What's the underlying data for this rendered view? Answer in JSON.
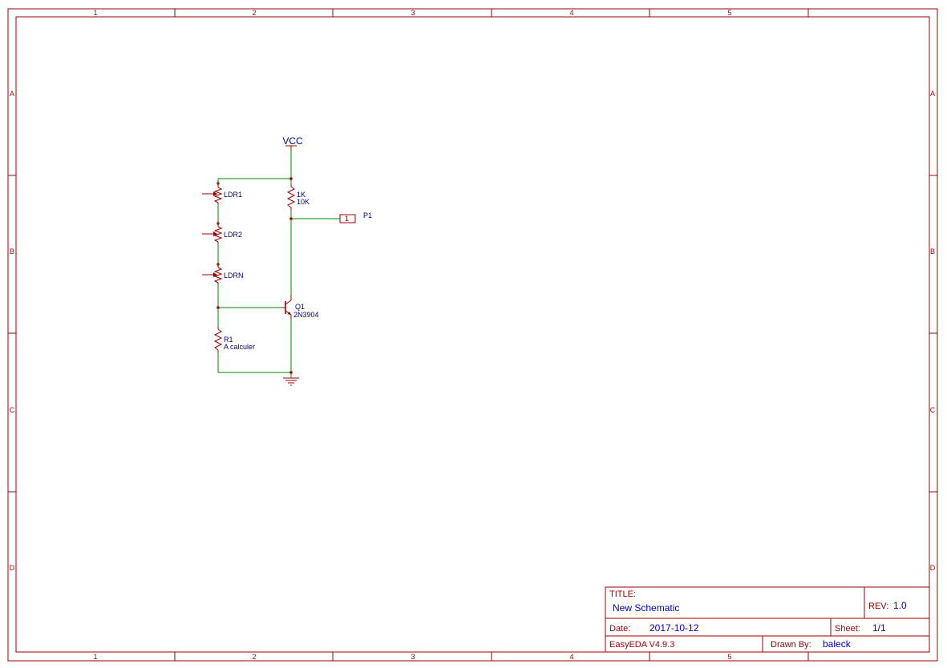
{
  "frame": {
    "columns": [
      "1",
      "2",
      "3",
      "4",
      "5"
    ],
    "rows": [
      "A",
      "B",
      "C",
      "D"
    ]
  },
  "schematic": {
    "vcc_label": "VCC",
    "ldr1": "LDR1",
    "ldr2": "LDR2",
    "ldrn": "LDRN",
    "r_top_name": "1K",
    "r_top_value": "10K",
    "port_name": "P1",
    "port_pin": "1",
    "q1_name": "Q1",
    "q1_value": "2N3904",
    "r1_name": "R1",
    "r1_value": "A calculer"
  },
  "title_block": {
    "title_key": "TITLE:",
    "title_value": "New Schematic",
    "rev_key": "REV:",
    "rev_value": "1.0",
    "date_key": "Date:",
    "date_value": "2017-10-12",
    "sheet_key": "Sheet:",
    "sheet_value": "1/1",
    "software": "EasyEDA V4.9.3",
    "drawn_key": "Drawn By:",
    "drawn_value": "baleck"
  },
  "colors": {
    "frame": "#990000",
    "wire": "#008800",
    "text": "#000080"
  }
}
